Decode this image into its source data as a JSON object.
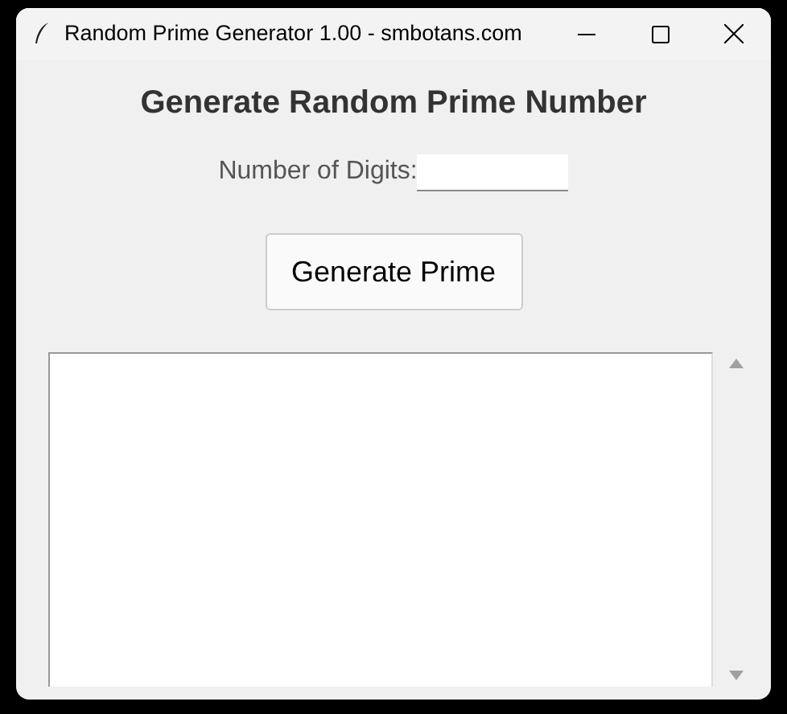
{
  "window": {
    "title": "Random Prime Generator 1.00 - smbotans.com"
  },
  "heading": "Generate Random Prime Number",
  "digits_field": {
    "label": "Number of Digits:"
  },
  "buttons": [
    "Generate Prime"
  ]
}
